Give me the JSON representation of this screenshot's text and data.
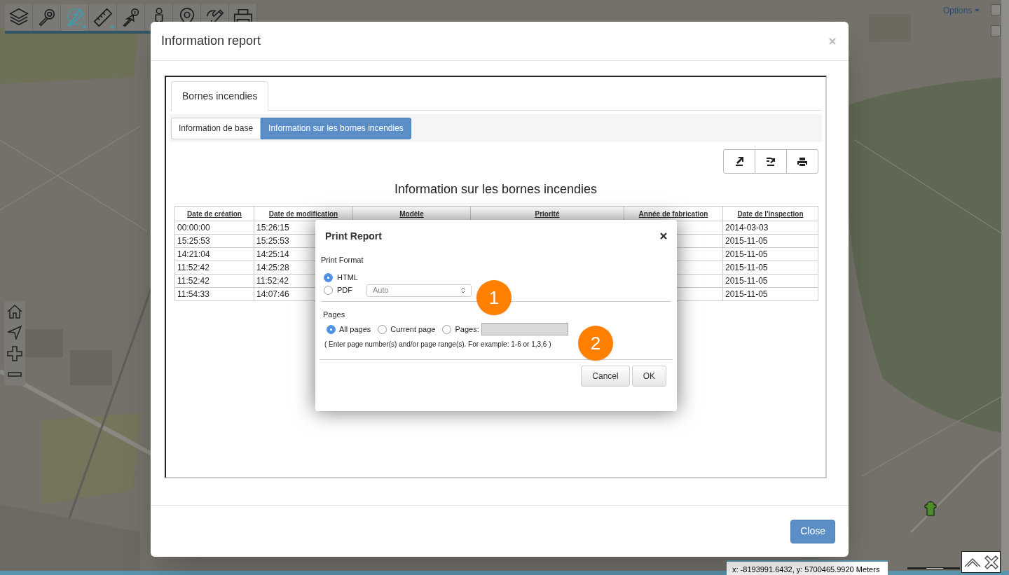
{
  "toolbar": {
    "tools": [
      {
        "kind": "layers",
        "selected": false,
        "has_menu": false
      },
      {
        "kind": "search",
        "selected": false,
        "has_menu": false
      },
      {
        "kind": "select",
        "selected": true,
        "has_menu": true
      },
      {
        "kind": "measure",
        "selected": false,
        "has_menu": true
      },
      {
        "kind": "info",
        "selected": false,
        "has_menu": false
      },
      {
        "kind": "person",
        "selected": false
      },
      {
        "kind": "pin",
        "selected": false
      },
      {
        "kind": "draw",
        "selected": false
      },
      {
        "kind": "print",
        "selected": false
      }
    ]
  },
  "options_menu": {
    "label": "Options"
  },
  "report_window": {
    "title": "Information report",
    "tabs": [
      {
        "label": "Bornes incendies",
        "selected": true
      }
    ],
    "subtabs": [
      {
        "label": "Information de base",
        "selected": false
      },
      {
        "label": "Information sur les bornes incendies",
        "selected": true
      }
    ],
    "heading": "Information sur les bornes incendies",
    "table": {
      "columns": [
        "Date de création",
        "Date de modification",
        "Modèle",
        "Priorité",
        "Année de fabrication",
        "Date de l'inspection"
      ],
      "rows": [
        {
          "created": "00:00:00",
          "modified": "15:26:15",
          "inspection": "2014-03-03"
        },
        {
          "created": "15:25:53",
          "modified": "15:25:53",
          "inspection": "2015-11-05"
        },
        {
          "created": "14:21:04",
          "modified": "14:25:14",
          "inspection": "2015-11-05"
        },
        {
          "created": "11:52:42",
          "modified": "14:25:28",
          "inspection": "2015-11-05"
        },
        {
          "created": "11:52:42",
          "modified": "11:52:42",
          "inspection": "2015-11-05"
        },
        {
          "created": "11:54:33",
          "modified": "14:07:46",
          "inspection": "2015-11-05"
        }
      ]
    },
    "close_button": "Close"
  },
  "print_dialog": {
    "title": "Print Report",
    "format_label": "Print Format",
    "formats": [
      {
        "label": "HTML",
        "selected": true
      },
      {
        "label": "PDF",
        "selected": false
      }
    ],
    "pdf_size": {
      "value": "Auto"
    },
    "pages_label": "Pages",
    "page_options": [
      {
        "label": "All pages",
        "selected": true
      },
      {
        "label": "Current page",
        "selected": false
      },
      {
        "label": "Pages:",
        "selected": false
      }
    ],
    "hint": "( Enter page number(s) and/or page range(s). For example: 1-6 or 1,3,6 )",
    "buttons": [
      "Cancel",
      "OK"
    ]
  },
  "annotations": [
    "1",
    "2"
  ],
  "status_bar": {
    "coordinates": "x: -8193991.6432, y: 5700465.9920 Meters"
  }
}
